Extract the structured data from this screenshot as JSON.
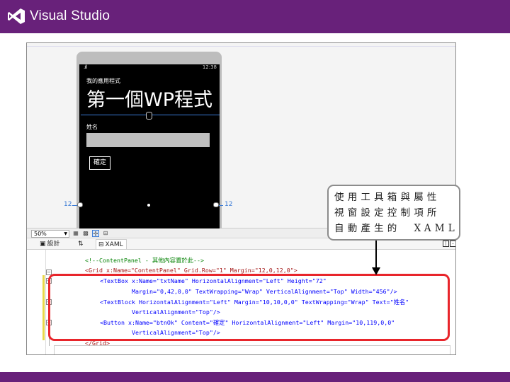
{
  "brand": {
    "name": "Visual Studio",
    "bar_color": "#68217a"
  },
  "phone": {
    "status_time": "12:38",
    "app_title": "我的應用程式",
    "page_title": "第一個WP程式",
    "name_label": "姓名",
    "ok_button": "確定",
    "margin_left": "12",
    "margin_right": "12"
  },
  "toolbar": {
    "zoom": "50%"
  },
  "tabs": {
    "design": "設計",
    "swap": "⇅",
    "xaml": "XAML"
  },
  "callout": {
    "line1": "使用工具箱與屬性",
    "line2": "視窗設定控制項所",
    "line3": "自動產生的  XAML"
  },
  "code_lines": [
    "<!--ContentPanel - 其他內容置於此-->",
    "<Grid x:Name=\"ContentPanel\" Grid.Row=\"1\" Margin=\"12,0,12,0\">",
    "<TextBox x:Name=\"txtName\" HorizontalAlignment=\"Left\" Height=\"72\"",
    "Margin=\"0,42,0,0\" TextWrapping=\"Wrap\" VerticalAlignment=\"Top\" Width=\"456\"/>",
    "<TextBlock HorizontalAlignment=\"Left\" Margin=\"10,10,0,0\" TextWrapping=\"Wrap\" Text=\"姓名\"",
    "VerticalAlignment=\"Top\"/>",
    "<Button x:Name=\"btnOk\" Content=\"確定\" HorizontalAlignment=\"Left\" Margin=\"10,119,0,0\"",
    "VerticalAlignment=\"Top\"/>",
    "</Grid>"
  ],
  "colors": {
    "highlight_box": "#e8252b",
    "selection": "#3b7bd6"
  }
}
